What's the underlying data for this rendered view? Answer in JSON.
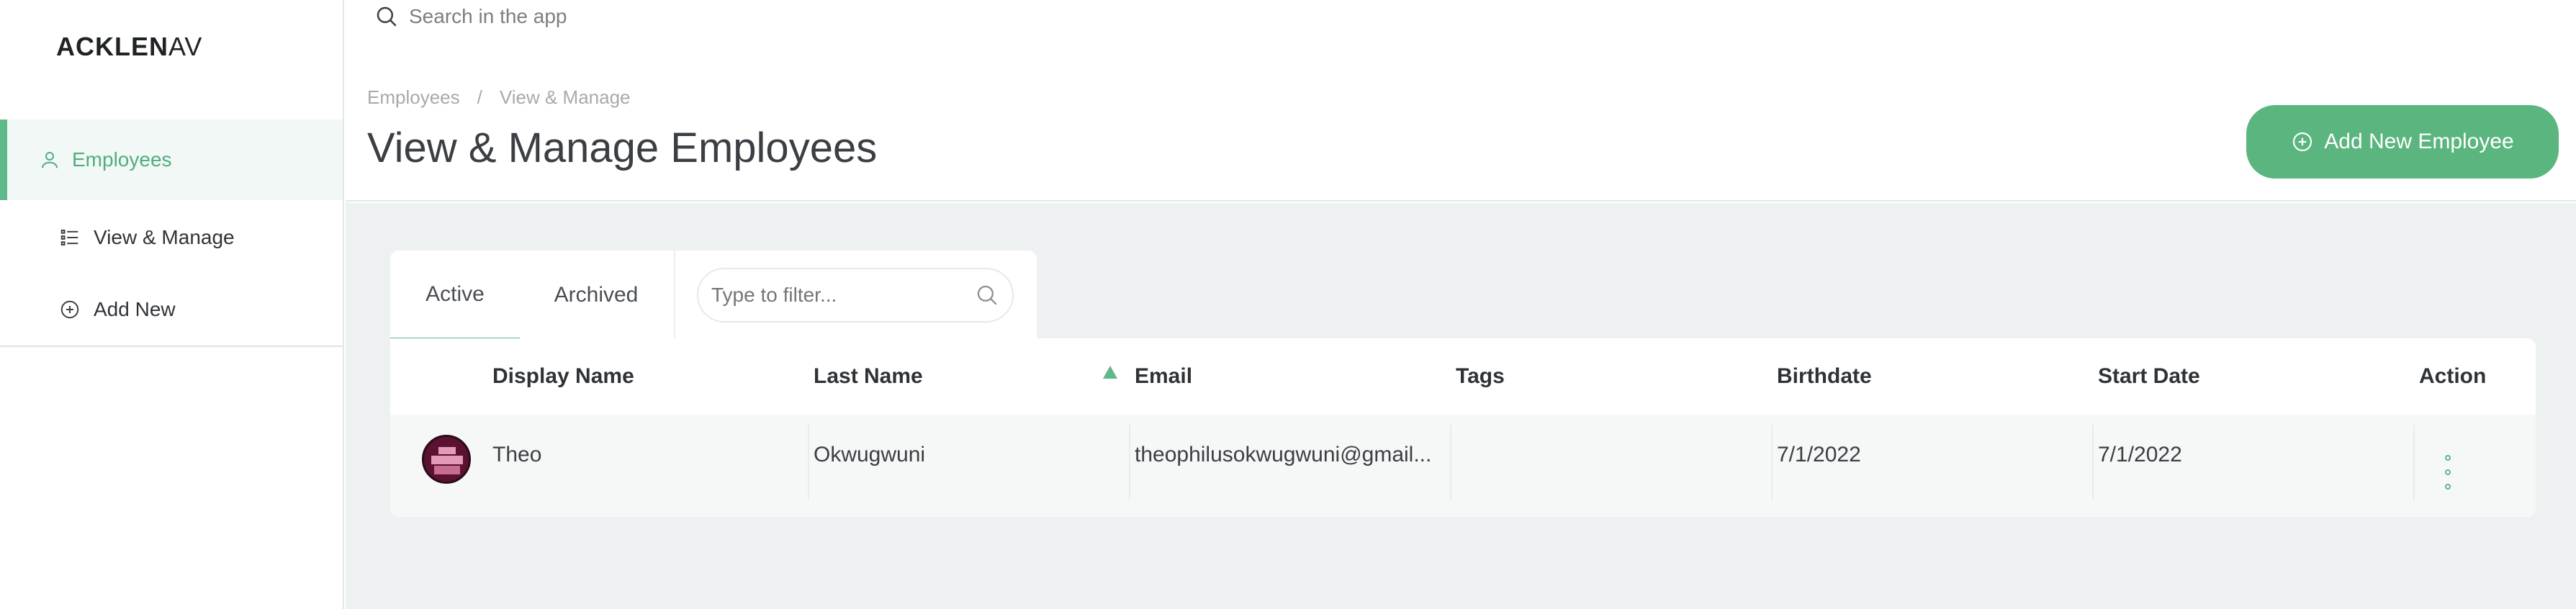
{
  "app": {
    "logo_text": "ACKLEN",
    "logo_suffix": "AV"
  },
  "sidebar": {
    "items": [
      {
        "label": "Employees",
        "icon": "user-icon",
        "active": true
      },
      {
        "label": "View & Manage",
        "icon": "list-icon"
      },
      {
        "label": "Add New",
        "icon": "plus-circle-icon"
      }
    ]
  },
  "search": {
    "placeholder": "Search in the app"
  },
  "breadcrumb": [
    "Employees",
    "/",
    "View & Manage"
  ],
  "page": {
    "title": "View & Manage Employees"
  },
  "actions": {
    "add_label": "Add New Employee"
  },
  "tabs": [
    {
      "label": "Active",
      "active": true
    },
    {
      "label": "Archived"
    }
  ],
  "filter": {
    "placeholder": "Type to filter..."
  },
  "table": {
    "columns": [
      "Display Name",
      "Last Name",
      "Email",
      "Tags",
      "Birthdate",
      "Start Date",
      "Action"
    ],
    "sorted_column": "Email",
    "rows": [
      {
        "display_name": "Theo",
        "last_name": "Okwugwuni",
        "email": "theophilusokwugwuni@gmail...",
        "tags": "",
        "birthdate": "7/1/2022",
        "start_date": "7/1/2022"
      }
    ]
  },
  "colors": {
    "accent": "#5bb57f",
    "background": "#eef1f1",
    "active_nav_bg": "#f1f8f6"
  }
}
